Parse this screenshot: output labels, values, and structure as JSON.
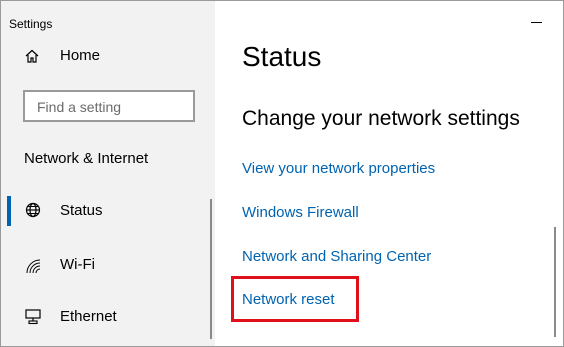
{
  "app": {
    "title": "Settings"
  },
  "sidebar": {
    "home_label": "Home",
    "search_placeholder": "Find a setting",
    "section_title": "Network & Internet",
    "items": [
      {
        "label": "Status",
        "icon": "globe-icon",
        "active": true
      },
      {
        "label": "Wi-Fi",
        "icon": "wifi-icon",
        "active": false
      },
      {
        "label": "Ethernet",
        "icon": "ethernet-icon",
        "active": false
      }
    ]
  },
  "main": {
    "title": "Status",
    "subheading": "Change your network settings",
    "links": [
      "View your network properties",
      "Windows Firewall",
      "Network and Sharing Center",
      "Network reset"
    ],
    "highlighted_link": "Network reset"
  },
  "colors": {
    "accent": "#0063b1",
    "highlight_border": "#e0101a",
    "sidebar_bg": "#f2f2f2"
  }
}
